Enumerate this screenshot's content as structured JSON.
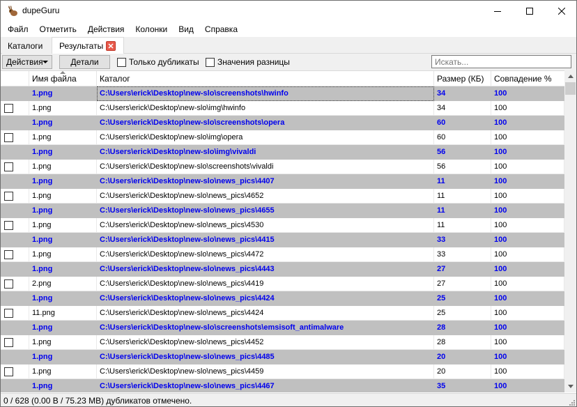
{
  "window": {
    "title": "dupeGuru",
    "icon": "dupeguru-rabbit-icon"
  },
  "menu": [
    "Файл",
    "Отметить",
    "Действия",
    "Колонки",
    "Вид",
    "Справка"
  ],
  "tabs": {
    "catalogs": "Каталоги",
    "results": "Результаты"
  },
  "toolbar": {
    "actions_label": "Действия",
    "details_label": "Детали",
    "only_dupes_label": "Только дубликаты",
    "delta_values_label": "Значения разницы",
    "search_placeholder": "Искать..."
  },
  "table": {
    "headers": {
      "name": "Имя файла",
      "folder": "Каталог",
      "size": "Размер (КБ)",
      "match": "Совпадение %"
    },
    "rows": [
      {
        "type": "ref",
        "name": "1.png",
        "folder": "C:\\Users\\erick\\Desktop\\new-slo\\screenshots\\hwinfo",
        "size": "34",
        "match": "100"
      },
      {
        "type": "dup",
        "name": "1.png",
        "folder": "C:\\Users\\erick\\Desktop\\new-slo\\img\\hwinfo",
        "size": "34",
        "match": "100"
      },
      {
        "type": "ref",
        "name": "1.png",
        "folder": "C:\\Users\\erick\\Desktop\\new-slo\\screenshots\\opera",
        "size": "60",
        "match": "100"
      },
      {
        "type": "dup",
        "name": "1.png",
        "folder": "C:\\Users\\erick\\Desktop\\new-slo\\img\\opera",
        "size": "60",
        "match": "100"
      },
      {
        "type": "ref",
        "name": "1.png",
        "folder": "C:\\Users\\erick\\Desktop\\new-slo\\img\\vivaldi",
        "size": "56",
        "match": "100"
      },
      {
        "type": "dup",
        "name": "1.png",
        "folder": "C:\\Users\\erick\\Desktop\\new-slo\\screenshots\\vivaldi",
        "size": "56",
        "match": "100"
      },
      {
        "type": "ref",
        "name": "1.png",
        "folder": "C:\\Users\\erick\\Desktop\\new-slo\\news_pics\\4407",
        "size": "11",
        "match": "100"
      },
      {
        "type": "dup",
        "name": "1.png",
        "folder": "C:\\Users\\erick\\Desktop\\new-slo\\news_pics\\4652",
        "size": "11",
        "match": "100"
      },
      {
        "type": "ref",
        "name": "1.png",
        "folder": "C:\\Users\\erick\\Desktop\\new-slo\\news_pics\\4655",
        "size": "11",
        "match": "100"
      },
      {
        "type": "dup",
        "name": "1.png",
        "folder": "C:\\Users\\erick\\Desktop\\new-slo\\news_pics\\4530",
        "size": "11",
        "match": "100"
      },
      {
        "type": "ref",
        "name": "1.png",
        "folder": "C:\\Users\\erick\\Desktop\\new-slo\\news_pics\\4415",
        "size": "33",
        "match": "100"
      },
      {
        "type": "dup",
        "name": "1.png",
        "folder": "C:\\Users\\erick\\Desktop\\new-slo\\news_pics\\4472",
        "size": "33",
        "match": "100"
      },
      {
        "type": "ref",
        "name": "1.png",
        "folder": "C:\\Users\\erick\\Desktop\\new-slo\\news_pics\\4443",
        "size": "27",
        "match": "100"
      },
      {
        "type": "dup",
        "name": "2.png",
        "folder": "C:\\Users\\erick\\Desktop\\new-slo\\news_pics\\4419",
        "size": "27",
        "match": "100"
      },
      {
        "type": "ref",
        "name": "1.png",
        "folder": "C:\\Users\\erick\\Desktop\\new-slo\\news_pics\\4424",
        "size": "25",
        "match": "100"
      },
      {
        "type": "dup",
        "name": "11.png",
        "folder": "C:\\Users\\erick\\Desktop\\new-slo\\news_pics\\4424",
        "size": "25",
        "match": "100"
      },
      {
        "type": "ref",
        "name": "1.png",
        "folder": "C:\\Users\\erick\\Desktop\\new-slo\\screenshots\\emsisoft_antimalware",
        "size": "28",
        "match": "100"
      },
      {
        "type": "dup",
        "name": "1.png",
        "folder": "C:\\Users\\erick\\Desktop\\new-slo\\news_pics\\4452",
        "size": "28",
        "match": "100"
      },
      {
        "type": "ref",
        "name": "1.png",
        "folder": "C:\\Users\\erick\\Desktop\\new-slo\\news_pics\\4485",
        "size": "20",
        "match": "100"
      },
      {
        "type": "dup",
        "name": "1.png",
        "folder": "C:\\Users\\erick\\Desktop\\new-slo\\news_pics\\4459",
        "size": "20",
        "match": "100"
      },
      {
        "type": "ref",
        "name": "1.png",
        "folder": "C:\\Users\\erick\\Desktop\\new-slo\\news_pics\\4467",
        "size": "35",
        "match": "100"
      }
    ]
  },
  "status": "0 / 628 (0.00 B / 75.23 MB) дубликатов отмечено.",
  "colors": {
    "ref_row_bg": "#c0c0c0",
    "ref_row_text": "#0000ee",
    "close_tab": "#e8594b"
  }
}
